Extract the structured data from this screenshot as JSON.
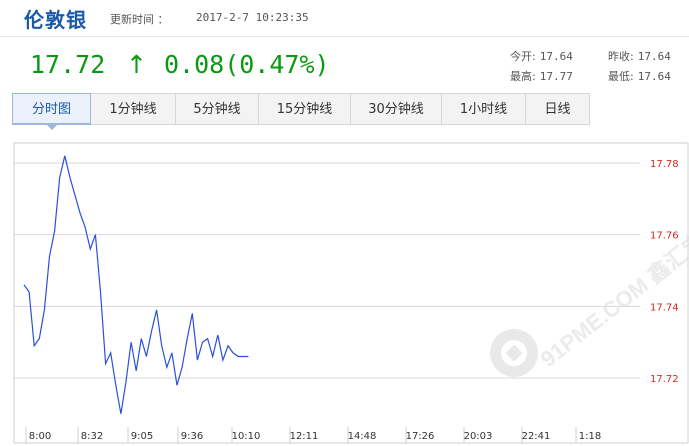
{
  "header": {
    "title": "伦敦银",
    "update_label": "更新时间 ：",
    "update_time": "2017-2-7 10:23:35"
  },
  "quote": {
    "price": "17.72",
    "arrow": "↑",
    "change": "0.08(0.47%)",
    "open_label": "今开:",
    "open": "17.64",
    "prev_close_label": "昨收:",
    "prev_close": "17.64",
    "high_label": "最高:",
    "high": "17.77",
    "low_label": "最低:",
    "low": "17.64"
  },
  "tabs": [
    {
      "label": "分时图",
      "active": true
    },
    {
      "label": "1分钟线",
      "active": false
    },
    {
      "label": "5分钟线",
      "active": false
    },
    {
      "label": "15分钟线",
      "active": false
    },
    {
      "label": "30分钟线",
      "active": false
    },
    {
      "label": "1小时线",
      "active": false
    },
    {
      "label": "日线",
      "active": false
    }
  ],
  "watermark": "91PME.COM 鑫汇宝贵金属",
  "colors": {
    "title": "#1a5aa8",
    "price_up": "#0a9a12",
    "line": "#2a4fe0",
    "axis_label": "#d42a20",
    "grid": "#d8d8d8"
  },
  "chart_data": {
    "type": "line",
    "x_ticks": [
      "8:00",
      "8:32",
      "9:05",
      "9:36",
      "10:10",
      "12:11",
      "14:48",
      "17:26",
      "20:03",
      "22:41",
      "1:18"
    ],
    "y_ticks": [
      "17.78",
      "17.76",
      "17.74",
      "17.72"
    ],
    "ylim": [
      17.705,
      17.785
    ],
    "grid": true,
    "series": [
      {
        "x_minutes": [
          0,
          3,
          6,
          9,
          12,
          15,
          18,
          21,
          24,
          27,
          30,
          33,
          36,
          39,
          42,
          45,
          48,
          51,
          54,
          57,
          60,
          63,
          66,
          69,
          72,
          75,
          78,
          81,
          84,
          87,
          90,
          93,
          96,
          99,
          102,
          105,
          108,
          111,
          114,
          117,
          120,
          123,
          126,
          129,
          132
        ],
        "values": [
          17.746,
          17.744,
          17.729,
          17.731,
          17.739,
          17.754,
          17.761,
          17.776,
          17.782,
          17.776,
          17.771,
          17.766,
          17.762,
          17.756,
          17.76,
          17.744,
          17.724,
          17.727,
          17.718,
          17.71,
          17.719,
          17.73,
          17.722,
          17.731,
          17.726,
          17.733,
          17.739,
          17.729,
          17.723,
          17.727,
          17.718,
          17.723,
          17.731,
          17.738,
          17.725,
          17.73,
          17.731,
          17.726,
          17.732,
          17.725,
          17.729,
          17.727,
          17.726,
          17.726,
          17.726
        ]
      }
    ]
  }
}
